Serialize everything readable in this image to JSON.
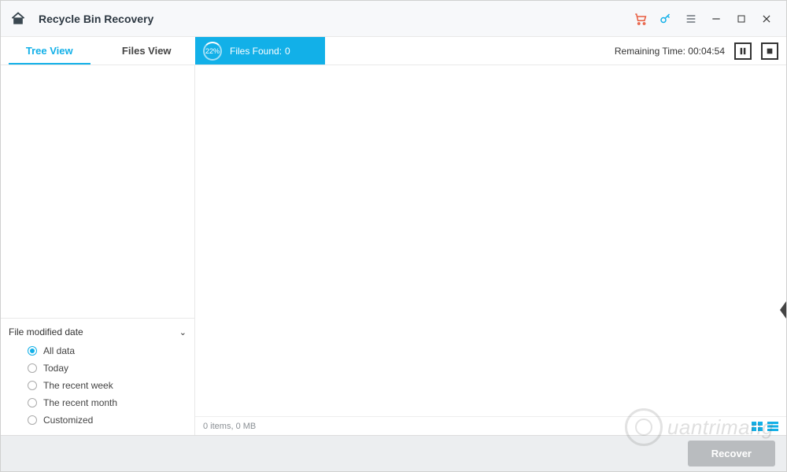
{
  "header": {
    "title": "Recycle Bin Recovery"
  },
  "tabs": {
    "tree": "Tree View",
    "files": "Files View",
    "active": "tree"
  },
  "scan": {
    "percent": "22%",
    "files_found_label": "Files Found:",
    "files_found_value": "0",
    "remaining_label": "Remaining Time:",
    "remaining_value": "00:04:54"
  },
  "filter": {
    "section_label": "File modified date",
    "options": [
      "All data",
      "Today",
      "The recent week",
      "The recent month",
      "Customized"
    ],
    "selected": 0
  },
  "status": {
    "summary": "0 items, 0 MB"
  },
  "footer": {
    "recover_label": "Recover"
  },
  "watermark": {
    "text": "uantrimang"
  },
  "colors": {
    "accent": "#12b0e8",
    "cart": "#e85c3f"
  }
}
